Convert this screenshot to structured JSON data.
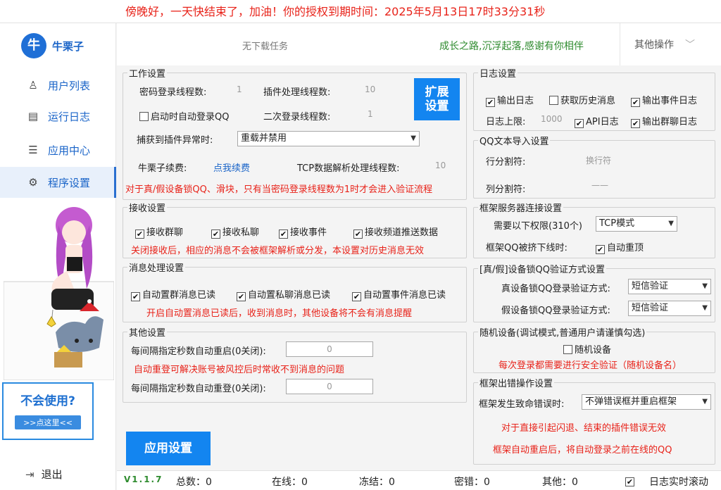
{
  "banner": {
    "text": "傍晚好，一天快结束了，加油！你的授权到期时间：2025年5月13日17时33分31秒"
  },
  "app": {
    "logo_text": "牛栗子",
    "logo_glyph": "牛"
  },
  "sidebar": {
    "items": [
      {
        "label": "用户列表",
        "icon": "user-icon",
        "glyph": "♙"
      },
      {
        "label": "运行日志",
        "icon": "log-icon",
        "glyph": "▤"
      },
      {
        "label": "应用中心",
        "icon": "list-icon",
        "glyph": "☰"
      },
      {
        "label": "程序设置",
        "icon": "gear-icon",
        "glyph": "⚙"
      }
    ],
    "help_title": "不会使用?",
    "help_button": ">>点这里<<",
    "logout": "退出",
    "logout_glyph": "⇥"
  },
  "topbar": {
    "task": "无下载任务",
    "motto": "成长之路,沉浮起落,感谢有你相伴",
    "other_ops": "其他操作"
  },
  "work": {
    "title": "工作设置",
    "pwd_threads_label": "密码登录线程数:",
    "pwd_threads_value": "1",
    "plugin_threads_label": "插件处理线程数:",
    "plugin_threads_value": "10",
    "auto_login_label": "启动时自动登录QQ",
    "second_threads_label": "二次登录线程数:",
    "second_threads_value": "1",
    "exception_label": "捕获到插件异常时:",
    "exception_value": "重载并禁用",
    "renew_label": "牛栗子续费:",
    "renew_link": "点我续费",
    "tcp_threads_label": "TCP数据解析处理线程数:",
    "tcp_threads_value": "10",
    "warning": "对于真/假设备锁QQ、滑块，只有当密码登录线程数为1时才会进入验证流程",
    "expand_button": "扩展设置"
  },
  "receive": {
    "title": "接收设置",
    "group": "接收群聊",
    "private": "接收私聊",
    "event": "接收事件",
    "channel": "接收频道推送数据",
    "warning": "关闭接收后，相应的消息不会被框架解析或分发，本设置对历史消息无效"
  },
  "message": {
    "title": "消息处理设置",
    "group": "自动置群消息已读",
    "private": "自动置私聊消息已读",
    "event": "自动置事件消息已读",
    "warning": "开启自动置消息已读后，收到消息时，其他设备将不会有消息提醒"
  },
  "other": {
    "title": "其他设置",
    "restart_label": "每间隔指定秒数自动重启(0关闭):",
    "restart_value": "0",
    "relogin_warning": "自动重登可解决账号被风控后时常收不到消息的问题",
    "relogin_label": "每间隔指定秒数自动重登(0关闭):",
    "relogin_value": "0"
  },
  "apply_button": "应用设置",
  "log": {
    "title": "日志设置",
    "output": "输出日志",
    "history": "获取历史消息",
    "event": "输出事件日志",
    "limit_label": "日志上限:",
    "limit_value": "1000",
    "api": "API日志",
    "group": "输出群聊日志"
  },
  "import": {
    "title": "QQ文本导入设置",
    "row_label": "行分割符:",
    "row_value": "换行符",
    "col_label": "列分割符:",
    "col_value": "——"
  },
  "server": {
    "title": "框架服务器连接设置",
    "perm_label": "需要以下权限(310个)",
    "perm_value": "TCP模式",
    "kick_label": "框架QQ被挤下线时:",
    "kick_value": "自动重顶"
  },
  "device": {
    "title": "[真/假]设备锁QQ验证方式设置",
    "real_label": "真设备锁QQ登录验证方式:",
    "real_value": "短信验证",
    "fake_label": "假设备锁QQ登录验证方式:",
    "fake_value": "短信验证"
  },
  "random": {
    "title": "随机设备(调试模式,普通用户请谨慎勾选)",
    "checkbox": "随机设备",
    "warning": "每次登录都需要进行安全验证（随机设备名）"
  },
  "error": {
    "title": "框架出错操作设置",
    "fatal_label": "框架发生致命错误时:",
    "fatal_value": "不弹错误框并重启框架",
    "note1": "对于直接引起闪退、结束的插件错误无效",
    "note2": "框架自动重启后，将自动登录之前在线的QQ"
  },
  "status": {
    "version": "V1.1.7",
    "total": "总数：0",
    "online": "在线：0",
    "frozen": "冻结：0",
    "pwd_err": "密错：0",
    "other": "其他：0",
    "scroll": "日志实时滚动"
  },
  "colors": {
    "accent": "#1385f0",
    "warning": "#e8231a",
    "motto": "#2e8b2e"
  }
}
